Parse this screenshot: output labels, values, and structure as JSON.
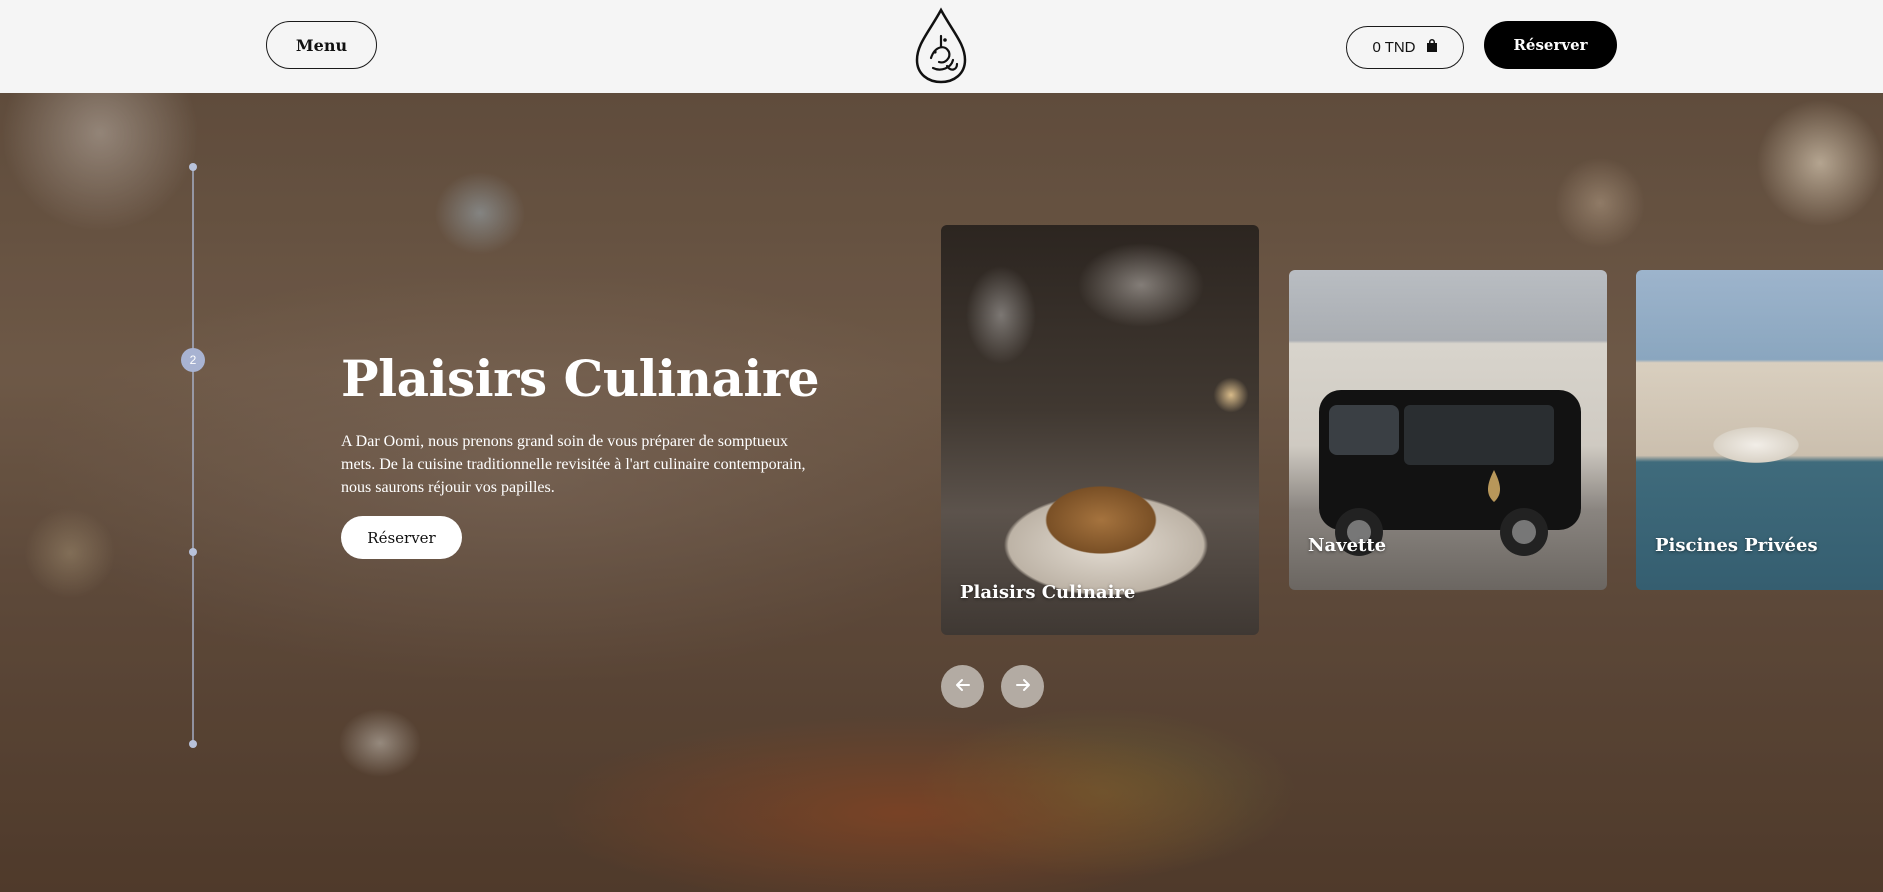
{
  "header": {
    "menu_label": "Menu",
    "cart_label": "0 TND",
    "reserve_label": "Réserver"
  },
  "side_nav": {
    "active_index": "2"
  },
  "hero": {
    "title": "Plaisirs Culinaire",
    "description": "A Dar Oomi, nous prenons grand soin de vous préparer de somptueux mets. De la cuisine traditionnelle revisitée à l'art culinaire contemporain, nous saurons réjouir vos papilles.",
    "cta_label": "Réserver"
  },
  "cards": [
    {
      "label": "Plaisirs Culinaire"
    },
    {
      "label": "Navette"
    },
    {
      "label": "Piscines Privées"
    }
  ],
  "icons": {
    "logo": "dar-oomi-logo-icon",
    "cart": "shopping-bag-icon",
    "prev": "arrow-left-icon",
    "next": "arrow-right-icon"
  }
}
